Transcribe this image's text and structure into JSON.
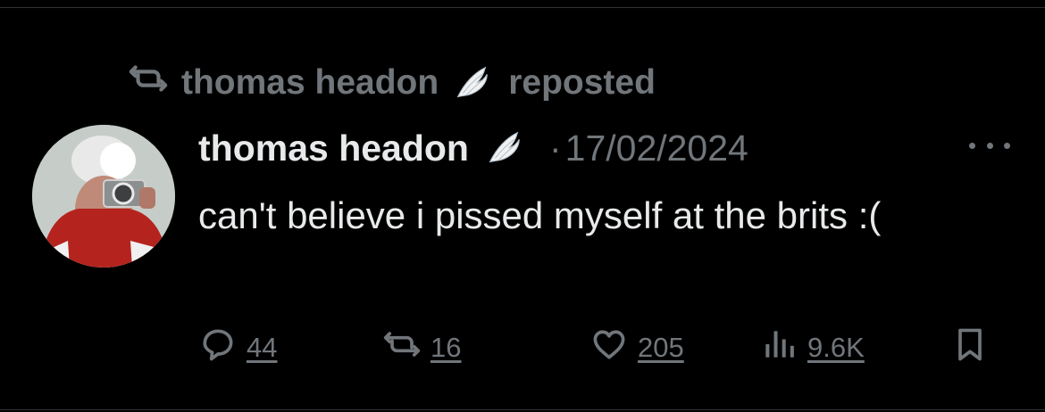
{
  "repost": {
    "user": "thomas headon",
    "label": "reposted"
  },
  "tweet": {
    "author": "thomas headon",
    "date": "17/02/2024",
    "text": "can't believe i pissed myself at the brits :("
  },
  "actions": {
    "replies": "44",
    "reposts": "16",
    "likes": "205",
    "views": "9.6K"
  },
  "icons": [
    "repost-icon",
    "wing-emoji-icon",
    "more-icon",
    "reply-icon",
    "like-icon",
    "views-icon",
    "bookmark-icon"
  ],
  "colors": {
    "background": "#000000",
    "primary_text": "#e7e9ea",
    "secondary_text": "#71767b"
  }
}
